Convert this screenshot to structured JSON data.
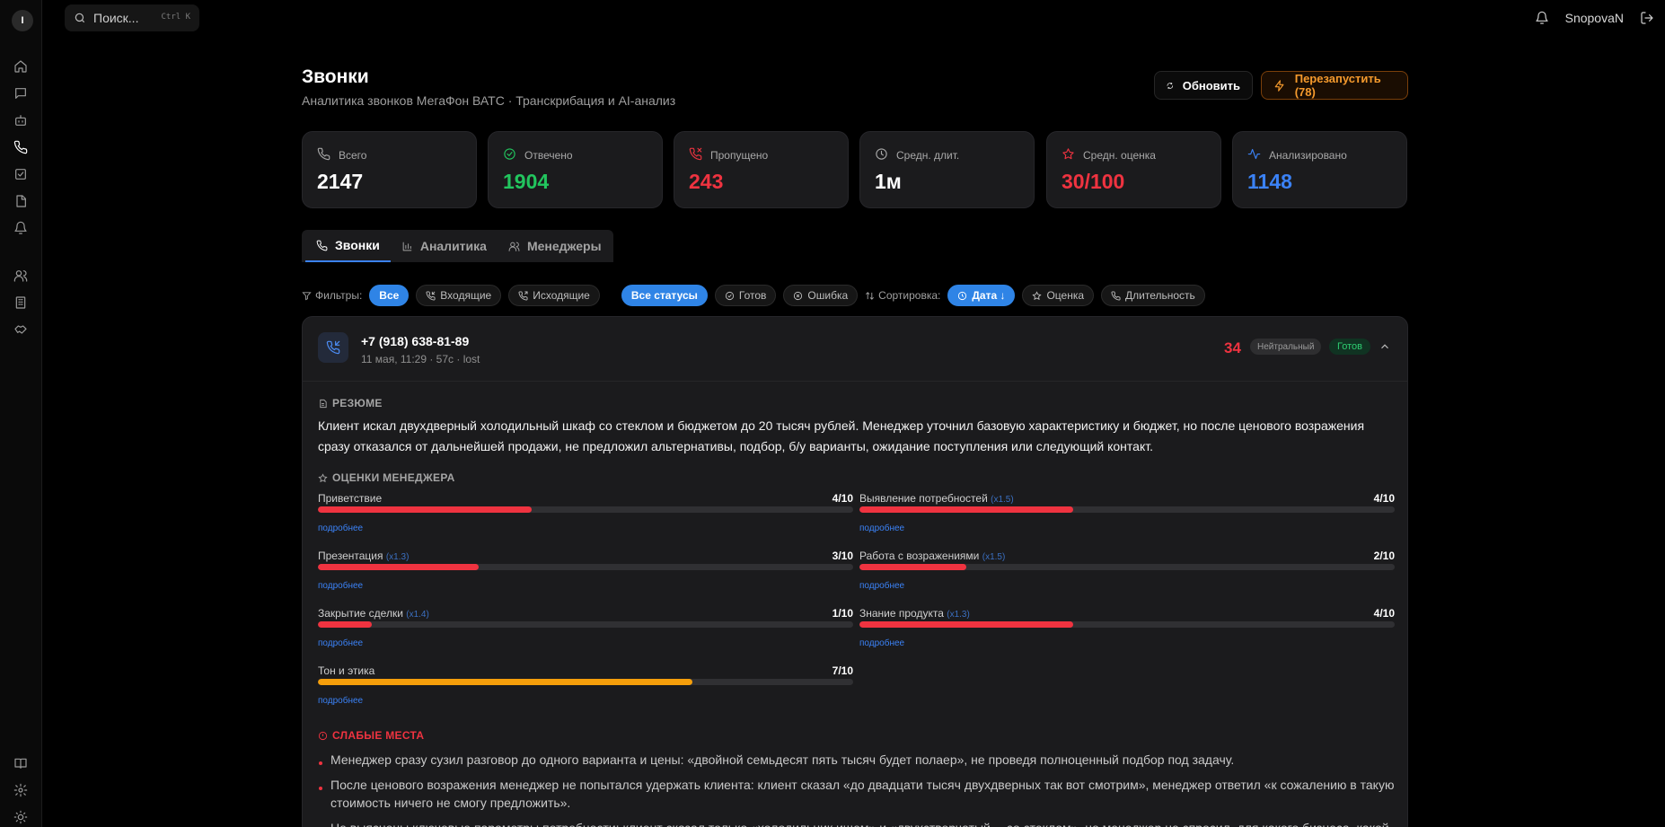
{
  "app": {
    "logo_letter": "I"
  },
  "search": {
    "label": "Поиск...",
    "shortcut": "Ctrl K"
  },
  "user": {
    "name": "SnopovaN"
  },
  "header": {
    "title": "Звонки",
    "subtitle": "Аналитика звонков МегаФон ВАТС · Транскрибация и AI-анализ",
    "refresh_label": "Обновить",
    "restart_label": "Перезапустить (78)"
  },
  "stats": [
    {
      "label": "Всего",
      "value": "2147",
      "color": "#ffffff",
      "icon": "phone-icon"
    },
    {
      "label": "Отвечено",
      "value": "1904",
      "color": "#22c55e",
      "icon": "check-circle-icon"
    },
    {
      "label": "Пропущено",
      "value": "243",
      "color": "#ef3340",
      "icon": "phone-missed-icon"
    },
    {
      "label": "Средн. длит.",
      "value": "1м",
      "color": "#ffffff",
      "icon": "clock-icon"
    },
    {
      "label": "Средн. оценка",
      "value": "30/100",
      "color": "#ef3340",
      "icon": "star-icon"
    },
    {
      "label": "Анализировано",
      "value": "1148",
      "color": "#3b82f6",
      "icon": "activity-icon"
    }
  ],
  "tabs": [
    {
      "label": "Звонки",
      "active": true
    },
    {
      "label": "Аналитика",
      "active": false
    },
    {
      "label": "Менеджеры",
      "active": false
    }
  ],
  "filters": {
    "label": "Фильтры:",
    "direction": [
      "Все",
      "Входящие",
      "Исходящие"
    ],
    "status": [
      "Все статусы",
      "Готов",
      "Ошибка"
    ],
    "sort_label": "Сортировка:",
    "sort": [
      "Дата ↓",
      "Оценка",
      "Длительность"
    ]
  },
  "call": {
    "phone": "+7 (918) 638-81-89",
    "meta": "11 мая, 11:29 · 57с · lost",
    "score": "34",
    "sentiment": "Нейтральный",
    "status": "Готов",
    "summary_title": "РЕЗЮМЕ",
    "summary": "Клиент искал двухдверный холодильный шкаф со стеклом и бюджетом до 20 тысяч рублей. Менеджер уточнил базовую характеристику и бюджет, но после ценового возражения сразу отказался от дальнейшей продажи, не предложил альтернативы, подбор, б/у варианты, ожидание поступления или следующий контакт.",
    "scores_title": "ОЦЕНКИ МЕНЕДЖЕРА",
    "more_label": "подробнее",
    "scores": [
      {
        "name": "Приветствие",
        "weight": "",
        "value": "4/10",
        "fraction": 0.4,
        "color": "#ef3340"
      },
      {
        "name": "Выявление потребностей",
        "weight": "(x1.5)",
        "value": "4/10",
        "fraction": 0.4,
        "color": "#ef3340"
      },
      {
        "name": "Презентация",
        "weight": "(x1.3)",
        "value": "3/10",
        "fraction": 0.3,
        "color": "#ef3340"
      },
      {
        "name": "Работа с возражениями",
        "weight": "(x1.5)",
        "value": "2/10",
        "fraction": 0.2,
        "color": "#ef3340"
      },
      {
        "name": "Закрытие сделки",
        "weight": "(x1.4)",
        "value": "1/10",
        "fraction": 0.1,
        "color": "#ef3340"
      },
      {
        "name": "Знание продукта",
        "weight": "(x1.3)",
        "value": "4/10",
        "fraction": 0.4,
        "color": "#ef3340"
      },
      {
        "name": "Тон и этика",
        "weight": "",
        "value": "7/10",
        "fraction": 0.7,
        "color": "#f59e0b"
      }
    ],
    "weak_title": "СЛАБЫЕ МЕСТА",
    "weak_points": [
      "Менеджер сразу сузил разговор до одного варианта и цены: «двойной семьдесят пять тысяч будет полаер», не проведя полноценный подбор под задачу.",
      "После ценового возражения менеджер не попытался удержать клиента: клиент сказал «до двадцати тысяч двухдверных так вот смотрим», менеджер ответил «к сожалению в такую стоимость ничего не смогу предложить».",
      "Не выяснены ключевые параметры потребности: клиент сказал только «холодильник ищем» и «двухстворчатый… со стеклом», но менеджер не спросил, для какого бизнеса, какой"
    ]
  }
}
